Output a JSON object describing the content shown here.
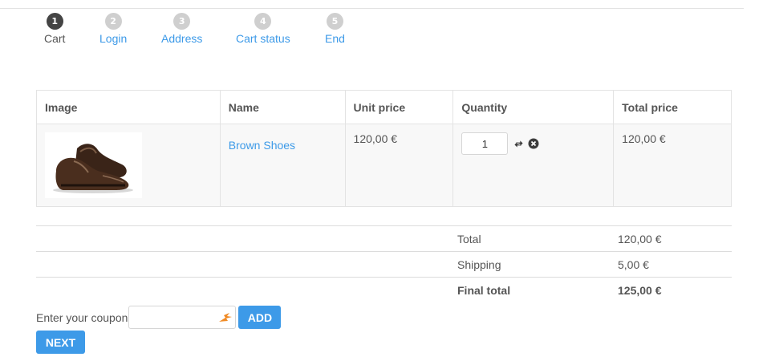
{
  "steps": [
    {
      "number": "1",
      "label": "Cart",
      "active": true
    },
    {
      "number": "2",
      "label": "Login",
      "active": false
    },
    {
      "number": "3",
      "label": "Address",
      "active": false
    },
    {
      "number": "4",
      "label": "Cart status",
      "active": false
    },
    {
      "number": "5",
      "label": "End",
      "active": false
    }
  ],
  "table": {
    "headers": {
      "image": "Image",
      "name": "Name",
      "unit_price": "Unit price",
      "quantity": "Quantity",
      "total_price": "Total price"
    },
    "rows": [
      {
        "product_name": "Brown Shoes",
        "unit_price": "120,00 €",
        "quantity": "1",
        "total_price": "120,00 €",
        "image_icon": "brown-shoes-image"
      }
    ]
  },
  "totals": {
    "total_label": "Total",
    "total_value": "120,00 €",
    "shipping_label": "Shipping",
    "shipping_value": "5,00 €",
    "final_label": "Final total",
    "final_value": "125,00 €"
  },
  "coupon": {
    "label": "Enter your coupon",
    "value": "",
    "add_label": "ADD"
  },
  "next_label": "NEXT",
  "colors": {
    "accent": "#3d9ae8",
    "step_active": "#444444",
    "step_inactive": "#cfcfcf",
    "text": "#555555"
  },
  "icons": {
    "refresh": "refresh-icon",
    "remove": "remove-icon",
    "coupon_field": "fill-helper-icon"
  }
}
